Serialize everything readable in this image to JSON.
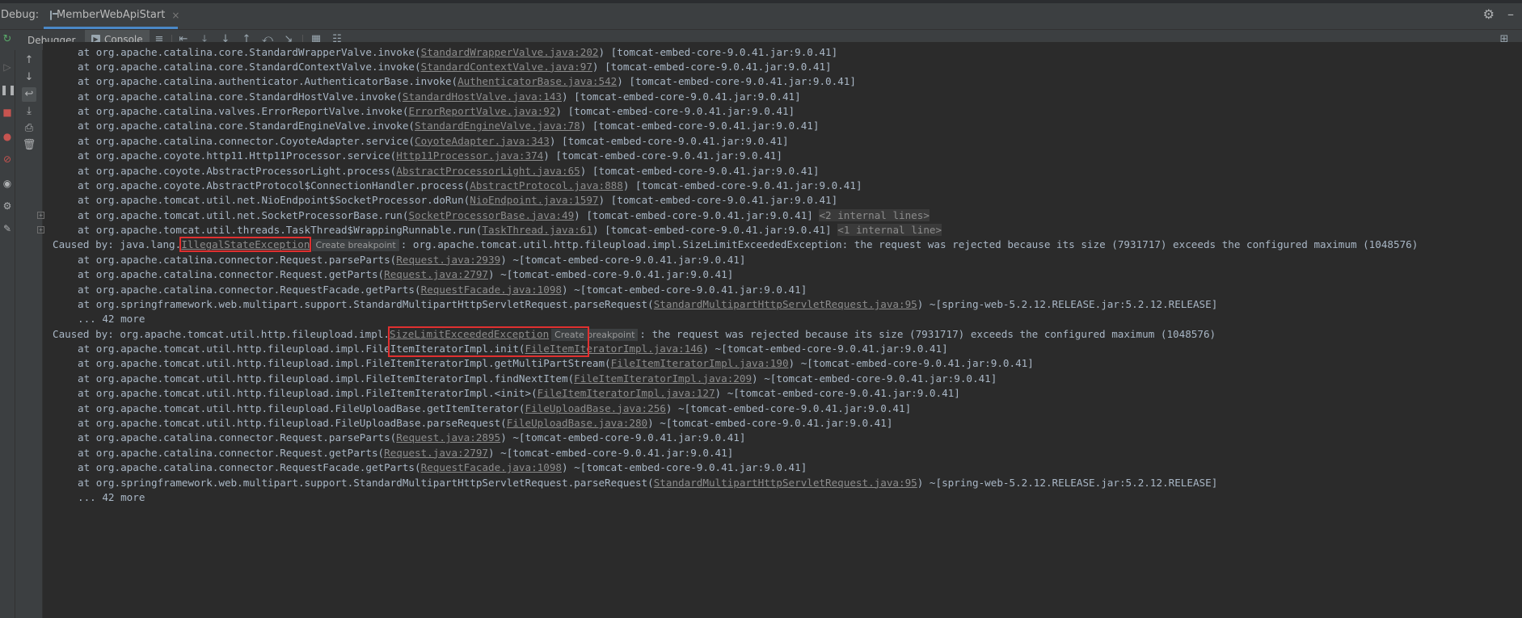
{
  "window": {
    "debug_label": "Debug:",
    "run_config": "MemberWebApiStart",
    "close_glyph": "×",
    "settings_glyph": "⚙",
    "minimize_glyph": "–"
  },
  "toolbar": {
    "debugger_tab": "Debugger",
    "console_tab": "Console",
    "layout_glyph": "⊞"
  },
  "colors": {
    "background": "#2b2b2b",
    "text": "#a9b7c6",
    "link": "#8c8c8c",
    "highlight_box": "#e03030",
    "accent": "#4a88c7"
  },
  "console": {
    "stack1": [
      {
        "pre": "at org.apache.catalina.core.StandardWrapperValve.invoke(",
        "link": "StandardWrapperValve.java:202",
        "post": ") [tomcat-embed-core-9.0.41.jar:9.0.41]"
      },
      {
        "pre": "at org.apache.catalina.core.StandardContextValve.invoke(",
        "link": "StandardContextValve.java:97",
        "post": ") [tomcat-embed-core-9.0.41.jar:9.0.41]"
      },
      {
        "pre": "at org.apache.catalina.authenticator.AuthenticatorBase.invoke(",
        "link": "AuthenticatorBase.java:542",
        "post": ") [tomcat-embed-core-9.0.41.jar:9.0.41]"
      },
      {
        "pre": "at org.apache.catalina.core.StandardHostValve.invoke(",
        "link": "StandardHostValve.java:143",
        "post": ") [tomcat-embed-core-9.0.41.jar:9.0.41]"
      },
      {
        "pre": "at org.apache.catalina.valves.ErrorReportValve.invoke(",
        "link": "ErrorReportValve.java:92",
        "post": ") [tomcat-embed-core-9.0.41.jar:9.0.41]"
      },
      {
        "pre": "at org.apache.catalina.core.StandardEngineValve.invoke(",
        "link": "StandardEngineValve.java:78",
        "post": ") [tomcat-embed-core-9.0.41.jar:9.0.41]"
      },
      {
        "pre": "at org.apache.catalina.connector.CoyoteAdapter.service(",
        "link": "CoyoteAdapter.java:343",
        "post": ") [tomcat-embed-core-9.0.41.jar:9.0.41]"
      },
      {
        "pre": "at org.apache.coyote.http11.Http11Processor.service(",
        "link": "Http11Processor.java:374",
        "post": ") [tomcat-embed-core-9.0.41.jar:9.0.41]"
      },
      {
        "pre": "at org.apache.coyote.AbstractProcessorLight.process(",
        "link": "AbstractProcessorLight.java:65",
        "post": ") [tomcat-embed-core-9.0.41.jar:9.0.41]"
      },
      {
        "pre": "at org.apache.coyote.AbstractProtocol$ConnectionHandler.process(",
        "link": "AbstractProtocol.java:888",
        "post": ") [tomcat-embed-core-9.0.41.jar:9.0.41]"
      },
      {
        "pre": "at org.apache.tomcat.util.net.NioEndpoint$SocketProcessor.doRun(",
        "link": "NioEndpoint.java:1597",
        "post": ") [tomcat-embed-core-9.0.41.jar:9.0.41]"
      },
      {
        "pre": "at org.apache.tomcat.util.net.SocketProcessorBase.run(",
        "link": "SocketProcessorBase.java:49",
        "post": ") [tomcat-embed-core-9.0.41.jar:9.0.41] ",
        "hint": "<2 internal lines>",
        "fold": true
      },
      {
        "pre": "at org.apache.tomcat.util.threads.TaskThread$WrappingRunnable.run(",
        "link": "TaskThread.java:61",
        "post": ") [tomcat-embed-core-9.0.41.jar:9.0.41] ",
        "hint": "<1 internal line>",
        "fold": true
      }
    ],
    "caused1": {
      "prefix": "Caused by: java.lang.",
      "exception": "IllegalStateException",
      "breakpoint_label": "Create breakpoint",
      "message": ": org.apache.tomcat.util.http.fileupload.impl.SizeLimitExceededException: the request was rejected because its size (7931717) exceeds the configured maximum (1048576)"
    },
    "stack2": [
      {
        "pre": "at org.apache.catalina.connector.Request.parseParts(",
        "link": "Request.java:2939",
        "post": ") ~[tomcat-embed-core-9.0.41.jar:9.0.41]"
      },
      {
        "pre": "at org.apache.catalina.connector.Request.getParts(",
        "link": "Request.java:2797",
        "post": ") ~[tomcat-embed-core-9.0.41.jar:9.0.41]"
      },
      {
        "pre": "at org.apache.catalina.connector.RequestFacade.getParts(",
        "link": "RequestFacade.java:1098",
        "post": ") ~[tomcat-embed-core-9.0.41.jar:9.0.41]"
      },
      {
        "pre": "at org.springframework.web.multipart.support.StandardMultipartHttpServletRequest.parseRequest(",
        "link": "StandardMultipartHttpServletRequest.java:95",
        "post": ") ~[spring-web-5.2.12.RELEASE.jar:5.2.12.RELEASE]"
      }
    ],
    "more1": "... 42 more",
    "caused2": {
      "prefix": "Caused by: org.apache.tomcat.util.http.fileupload.impl.",
      "exception": "SizeLimitExceededException",
      "breakpoint_label": "Create breakpoint",
      "message": ": the request was rejected because its size (7931717) exceeds the configured maximum (1048576)"
    },
    "stack3": [
      {
        "pre": "at org.apache.tomcat.util.http.fileupload.impl.FileItemIteratorImpl.init(",
        "link": "FileItemIteratorImpl.java:146",
        "post": ") ~[tomcat-embed-core-9.0.41.jar:9.0.41]"
      },
      {
        "pre": "at org.apache.tomcat.util.http.fileupload.impl.FileItemIteratorImpl.getMultiPartStream(",
        "link": "FileItemIteratorImpl.java:190",
        "post": ") ~[tomcat-embed-core-9.0.41.jar:9.0.41]"
      },
      {
        "pre": "at org.apache.tomcat.util.http.fileupload.impl.FileItemIteratorImpl.findNextItem(",
        "link": "FileItemIteratorImpl.java:209",
        "post": ") ~[tomcat-embed-core-9.0.41.jar:9.0.41]"
      },
      {
        "pre": "at org.apache.tomcat.util.http.fileupload.impl.FileItemIteratorImpl.<init>(",
        "link": "FileItemIteratorImpl.java:127",
        "post": ") ~[tomcat-embed-core-9.0.41.jar:9.0.41]"
      },
      {
        "pre": "at org.apache.tomcat.util.http.fileupload.FileUploadBase.getItemIterator(",
        "link": "FileUploadBase.java:256",
        "post": ") ~[tomcat-embed-core-9.0.41.jar:9.0.41]"
      },
      {
        "pre": "at org.apache.tomcat.util.http.fileupload.FileUploadBase.parseRequest(",
        "link": "FileUploadBase.java:280",
        "post": ") ~[tomcat-embed-core-9.0.41.jar:9.0.41]"
      },
      {
        "pre": "at org.apache.catalina.connector.Request.parseParts(",
        "link": "Request.java:2895",
        "post": ") ~[tomcat-embed-core-9.0.41.jar:9.0.41]"
      },
      {
        "pre": "at org.apache.catalina.connector.Request.getParts(",
        "link": "Request.java:2797",
        "post": ") ~[tomcat-embed-core-9.0.41.jar:9.0.41]"
      },
      {
        "pre": "at org.apache.catalina.connector.RequestFacade.getParts(",
        "link": "RequestFacade.java:1098",
        "post": ") ~[tomcat-embed-core-9.0.41.jar:9.0.41]"
      },
      {
        "pre": "at org.springframework.web.multipart.support.StandardMultipartHttpServletRequest.parseRequest(",
        "link": "StandardMultipartHttpServletRequest.java:95",
        "post": ") ~[spring-web-5.2.12.RELEASE.jar:5.2.12.RELEASE]"
      }
    ],
    "more2": "... 42 more"
  }
}
